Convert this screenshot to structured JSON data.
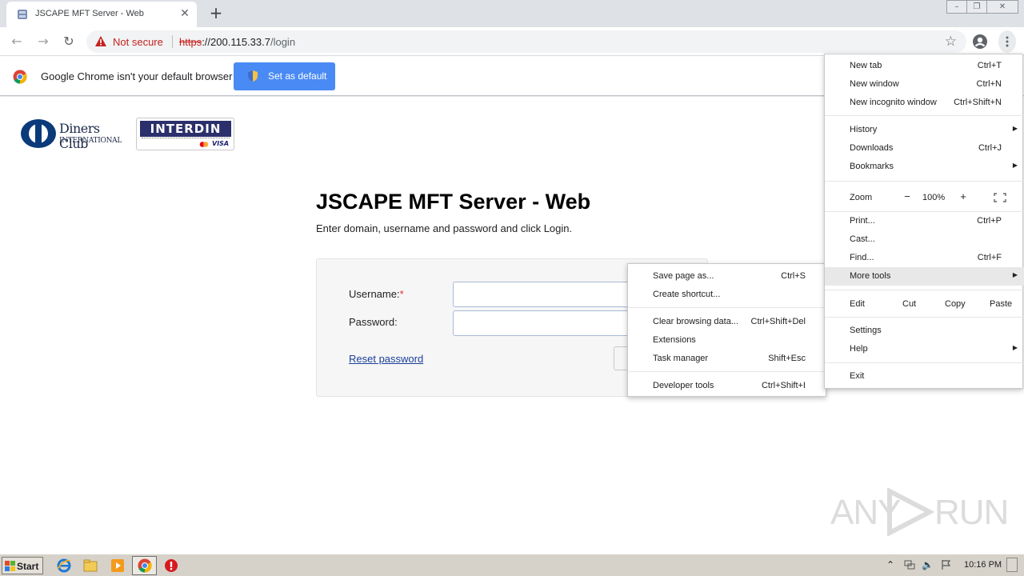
{
  "browser": {
    "tab_title": "JSCAPE MFT Server - Web",
    "url_scheme": "https",
    "url_host": "://200.115.33.7",
    "url_path": "/login",
    "security_label": "Not secure",
    "infobar_message": "Google Chrome isn't your default browser",
    "set_default_label": "Set as default"
  },
  "page": {
    "logo_diners_line1": "Diners Club",
    "logo_diners_line2": "INTERNATIONAL",
    "logo_interdin_a": "INTER",
    "logo_interdin_b": "DIN",
    "logo_visa": "VISA",
    "title": "JSCAPE MFT Server - Web",
    "subtitle": "Enter domain, username and password and click Login.",
    "username_label": "Username:",
    "required_mark": "*",
    "password_label": "Password:",
    "reset_link": "Reset password"
  },
  "main_menu": {
    "items": [
      {
        "label": "New tab",
        "shortcut": "Ctrl+T"
      },
      {
        "label": "New window",
        "shortcut": "Ctrl+N"
      },
      {
        "label": "New incognito window",
        "shortcut": "Ctrl+Shift+N"
      },
      {
        "label": "History",
        "shortcut": ""
      },
      {
        "label": "Downloads",
        "shortcut": "Ctrl+J"
      },
      {
        "label": "Bookmarks",
        "shortcut": ""
      },
      {
        "label": "Print...",
        "shortcut": "Ctrl+P"
      },
      {
        "label": "Cast...",
        "shortcut": ""
      },
      {
        "label": "Find...",
        "shortcut": "Ctrl+F"
      },
      {
        "label": "More tools",
        "shortcut": ""
      },
      {
        "label": "Settings",
        "shortcut": ""
      },
      {
        "label": "Help",
        "shortcut": ""
      },
      {
        "label": "Exit",
        "shortcut": ""
      }
    ],
    "zoom_label": "Zoom",
    "zoom_minus": "−",
    "zoom_value": "100%",
    "zoom_plus": "+",
    "edit_label": "Edit",
    "cut_label": "Cut",
    "copy_label": "Copy",
    "paste_label": "Paste"
  },
  "more_tools_menu": {
    "items": [
      {
        "label": "Save page as...",
        "shortcut": "Ctrl+S"
      },
      {
        "label": "Create shortcut...",
        "shortcut": ""
      },
      {
        "label": "Clear browsing data...",
        "shortcut": "Ctrl+Shift+Del"
      },
      {
        "label": "Extensions",
        "shortcut": ""
      },
      {
        "label": "Task manager",
        "shortcut": "Shift+Esc"
      },
      {
        "label": "Developer tools",
        "shortcut": "Ctrl+Shift+I"
      }
    ]
  },
  "watermark": {
    "left": "ANY",
    "right": "RUN"
  },
  "taskbar": {
    "start_label": "Start",
    "clock": "10:16 PM"
  },
  "colors": {
    "accent": "#4a8af4",
    "danger": "#c5221f",
    "taskbar": "#d6d2c9"
  }
}
